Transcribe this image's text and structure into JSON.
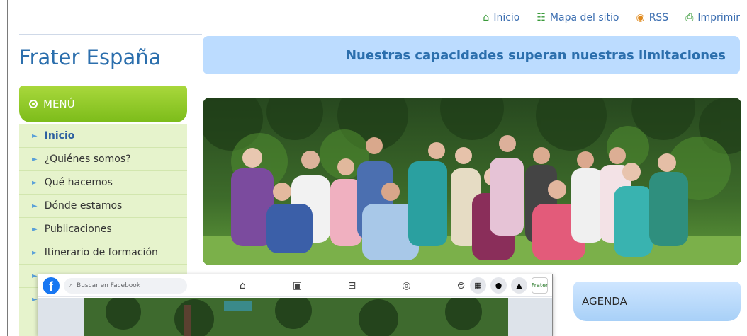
{
  "topnav": {
    "items": [
      {
        "label": "Inicio",
        "icon": "home-icon"
      },
      {
        "label": "Mapa del sitio",
        "icon": "sitemap-icon"
      },
      {
        "label": "RSS",
        "icon": "rss-icon"
      },
      {
        "label": "Imprimir",
        "icon": "print-icon"
      }
    ]
  },
  "site": {
    "title": "Frater España",
    "slogan": "Nuestras capacidades superan nuestras limitaciones"
  },
  "menu": {
    "heading": "MENÚ",
    "items": [
      {
        "label": "Inicio",
        "active": true
      },
      {
        "label": "¿Quiénes somos?"
      },
      {
        "label": "Qué hacemos"
      },
      {
        "label": "Dónde estamos"
      },
      {
        "label": "Publicaciones"
      },
      {
        "label": "Itinerario de formación"
      },
      {
        "label": ""
      },
      {
        "label": ""
      }
    ]
  },
  "agenda": {
    "heading": "AGENDA"
  },
  "facebook": {
    "search_placeholder": "Buscar en Facebook",
    "avatar_text": "Frater"
  },
  "colors": {
    "link_blue": "#2c6fad",
    "menu_green": "#8cc63f",
    "slogan_bg": "#bcdcff",
    "facebook_blue": "#1877f2"
  }
}
